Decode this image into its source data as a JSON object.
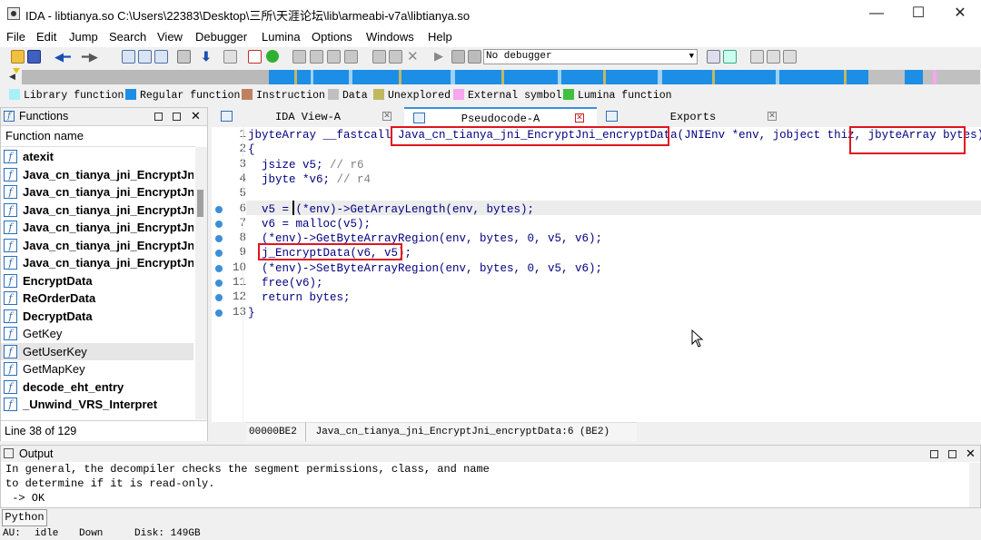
{
  "window": {
    "title": "IDA - libtianya.so C:\\Users\\22383\\Desktop\\三所\\天涯论坛\\lib\\armeabi-v7a\\libtianya.so",
    "minimize": "—",
    "maximize": "☐",
    "close": "✕"
  },
  "menu": [
    "File",
    "Edit",
    "Jump",
    "Search",
    "View",
    "Debugger",
    "Lumina",
    "Options",
    "Windows",
    "Help"
  ],
  "toolbar": {
    "debugger_select": "No debugger"
  },
  "legend": [
    {
      "label": "Library function",
      "color": "#a8f0f8"
    },
    {
      "label": "Regular function",
      "color": "#1c8ee6"
    },
    {
      "label": "Instruction",
      "color": "#c08060"
    },
    {
      "label": "Data",
      "color": "#c0c0c0"
    },
    {
      "label": "Unexplored",
      "color": "#c0b860"
    },
    {
      "label": "External symbol",
      "color": "#f7a6f0"
    },
    {
      "label": "Lumina function",
      "color": "#40c040"
    }
  ],
  "functions": {
    "title": "Functions",
    "column": "Function name",
    "items": [
      {
        "name": "atexit",
        "bold": true
      },
      {
        "name": "Java_cn_tianya_jni_EncryptJni_",
        "bold": true
      },
      {
        "name": "Java_cn_tianya_jni_EncryptJni_",
        "bold": true
      },
      {
        "name": "Java_cn_tianya_jni_EncryptJni_",
        "bold": true
      },
      {
        "name": "Java_cn_tianya_jni_EncryptJni_",
        "bold": true
      },
      {
        "name": "Java_cn_tianya_jni_EncryptJni_",
        "bold": true
      },
      {
        "name": "Java_cn_tianya_jni_EncryptJni_",
        "bold": true
      },
      {
        "name": "EncryptData",
        "bold": true
      },
      {
        "name": "ReOrderData",
        "bold": true
      },
      {
        "name": "DecryptData",
        "bold": true
      },
      {
        "name": "GetKey",
        "bold": false
      },
      {
        "name": "GetUserKey",
        "bold": false
      },
      {
        "name": "GetMapKey",
        "bold": false
      },
      {
        "name": "decode_eht_entry",
        "bold": true
      },
      {
        "name": "_Unwind_VRS_Interpret",
        "bold": true
      }
    ],
    "status": "Line 38 of 129"
  },
  "tabs": [
    {
      "label": "IDA View-A",
      "active": false
    },
    {
      "label": "Pseudocode-A",
      "active": true
    },
    {
      "label": "Exports",
      "active": false
    }
  ],
  "code": {
    "lines": [
      {
        "num": "1",
        "text": "jbyteArray __fastcall Java_cn_tianya_jni_EncryptJni_encryptData(JNIEnv *env, jobject thiz, jbyteArray bytes)",
        "dot": false
      },
      {
        "num": "2",
        "text": "{",
        "dot": false
      },
      {
        "num": "3",
        "text": "  jsize v5; // r6",
        "dot": false
      },
      {
        "num": "4",
        "text": "  jbyte *v6; // r4",
        "dot": false
      },
      {
        "num": "5",
        "text": "",
        "dot": false
      },
      {
        "num": "6",
        "text": "  v5 = (*env)->GetArrayLength(env, bytes);",
        "dot": true
      },
      {
        "num": "7",
        "text": "  v6 = malloc(v5);",
        "dot": true
      },
      {
        "num": "8",
        "text": "  (*env)->GetByteArrayRegion(env, bytes, 0, v5, v6);",
        "dot": true
      },
      {
        "num": "9",
        "text": "  j_EncryptData(v6, v5);",
        "dot": true
      },
      {
        "num": "10",
        "text": "  (*env)->SetByteArrayRegion(env, bytes, 0, v5, v6);",
        "dot": true
      },
      {
        "num": "11",
        "text": "  free(v6);",
        "dot": true
      },
      {
        "num": "12",
        "text": "  return bytes;",
        "dot": true
      },
      {
        "num": "13",
        "text": "}",
        "dot": true
      }
    ],
    "status_address": "00000BE2",
    "status_location": "Java_cn_tianya_jni_EncryptJni_encryptData:6 (BE2)"
  },
  "output": {
    "title": "Output",
    "lines": [
      "In general, the decompiler checks the segment permissions, class, and name",
      "to determine if it is read-only.",
      " -> OK"
    ],
    "python_button": "Python"
  },
  "statusbar": {
    "au": "AU:",
    "au_value": "idle",
    "direction": "Down",
    "disk": "Disk: 149GB"
  }
}
